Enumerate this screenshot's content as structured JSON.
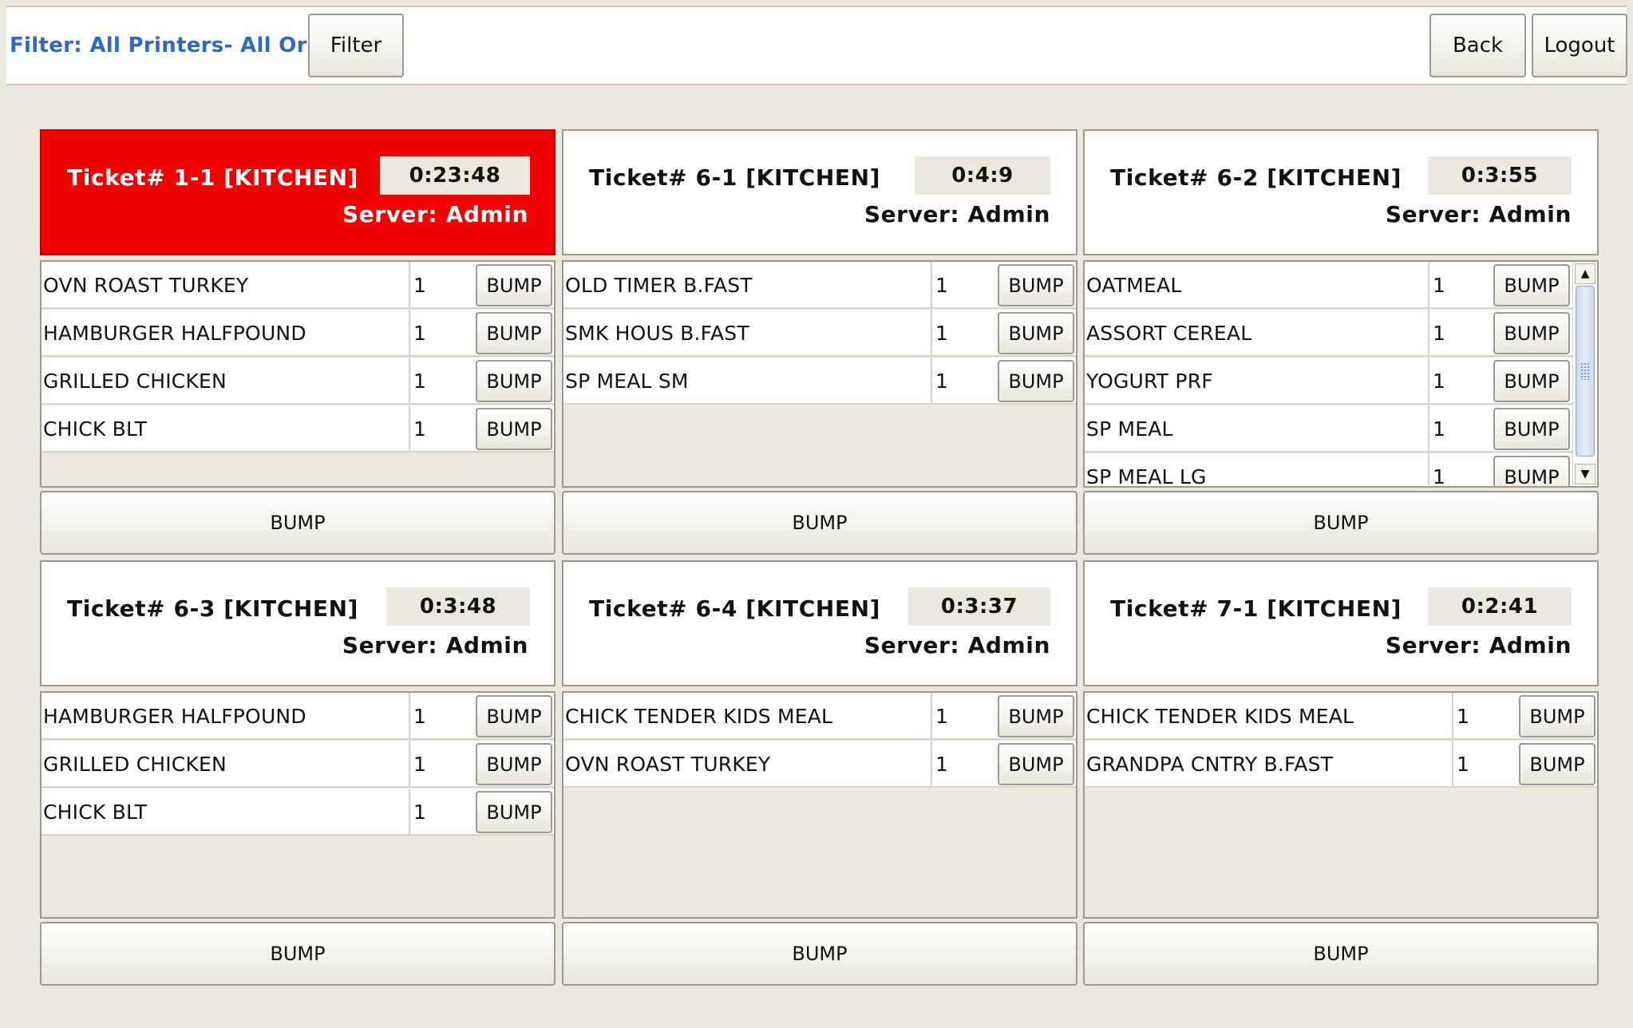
{
  "topbar": {
    "filter_text": "Filter: All Printers- All Orders",
    "filter_button": "Filter",
    "back_button": "Back",
    "logout_button": "Logout"
  },
  "colors": {
    "late_ticket": "#f20000",
    "filter_text": "#2e68c0",
    "background": "#ebe9dd"
  },
  "tickets": [
    {
      "title": "Ticket# 1-1 [KITCHEN]",
      "timer": "0:23:48",
      "server": "Server: Admin",
      "late": true,
      "items": [
        {
          "name": "OVN ROAST TURKEY",
          "qty": "1",
          "bump": "BUMP"
        },
        {
          "name": "HAMBURGER HALFPOUND",
          "qty": "1",
          "bump": "BUMP"
        },
        {
          "name": "GRILLED CHICKEN",
          "qty": "1",
          "bump": "BUMP"
        },
        {
          "name": "CHICK BLT",
          "qty": "1",
          "bump": "BUMP"
        }
      ],
      "bump_all": "BUMP"
    },
    {
      "title": "Ticket# 6-1 [KITCHEN]",
      "timer": "0:4:9",
      "server": "Server: Admin",
      "late": false,
      "items": [
        {
          "name": "OLD TIMER B.FAST",
          "qty": "1",
          "bump": "BUMP"
        },
        {
          "name": "SMK HOUS B.FAST",
          "qty": "1",
          "bump": "BUMP"
        },
        {
          "name": "SP MEAL SM",
          "qty": "1",
          "bump": "BUMP"
        }
      ],
      "bump_all": "BUMP"
    },
    {
      "title": "Ticket# 6-2 [KITCHEN]",
      "timer": "0:3:55",
      "server": "Server: Admin",
      "late": false,
      "items": [
        {
          "name": "OATMEAL",
          "qty": "1",
          "bump": "BUMP"
        },
        {
          "name": "ASSORT CEREAL",
          "qty": "1",
          "bump": "BUMP"
        },
        {
          "name": "YOGURT PRF",
          "qty": "1",
          "bump": "BUMP"
        },
        {
          "name": "SP MEAL",
          "qty": "1",
          "bump": "BUMP"
        },
        {
          "name": "SP MEAL LG",
          "qty": "1",
          "bump": "BUMP"
        }
      ],
      "bump_all": "BUMP"
    },
    {
      "title": "Ticket# 6-3 [KITCHEN]",
      "timer": "0:3:48",
      "server": "Server: Admin",
      "late": false,
      "items": [
        {
          "name": "HAMBURGER HALFPOUND",
          "qty": "1",
          "bump": "BUMP"
        },
        {
          "name": "GRILLED CHICKEN",
          "qty": "1",
          "bump": "BUMP"
        },
        {
          "name": "CHICK BLT",
          "qty": "1",
          "bump": "BUMP"
        }
      ],
      "bump_all": "BUMP"
    },
    {
      "title": "Ticket# 6-4 [KITCHEN]",
      "timer": "0:3:37",
      "server": "Server: Admin",
      "late": false,
      "items": [
        {
          "name": "CHICK TENDER KIDS MEAL",
          "qty": "1",
          "bump": "BUMP"
        },
        {
          "name": "OVN ROAST TURKEY",
          "qty": "1",
          "bump": "BUMP"
        }
      ],
      "bump_all": "BUMP"
    },
    {
      "title": "Ticket# 7-1 [KITCHEN]",
      "timer": "0:2:41",
      "server": "Server: Admin",
      "late": false,
      "items": [
        {
          "name": "CHICK TENDER KIDS MEAL",
          "qty": "1",
          "bump": "BUMP"
        },
        {
          "name": "GRANDPA CNTRY B.FAST",
          "qty": "1",
          "bump": "BUMP"
        }
      ],
      "bump_all": "BUMP"
    }
  ]
}
